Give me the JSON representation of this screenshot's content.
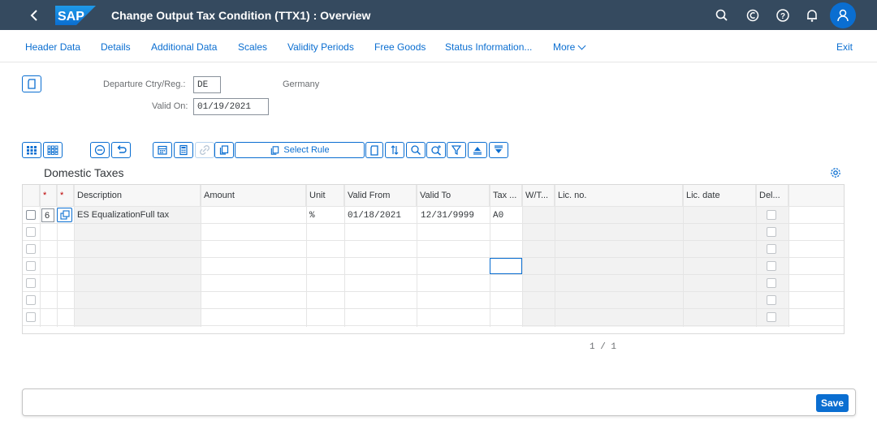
{
  "shell": {
    "title": "Change Output Tax Condition (TTX1) : Overview",
    "logo_text": "SAP"
  },
  "menu": {
    "items": [
      "Header Data",
      "Details",
      "Additional Data",
      "Scales",
      "Validity Periods",
      "Free Goods",
      "Status Information..."
    ],
    "more_label": "More",
    "exit_label": "Exit"
  },
  "form": {
    "country_label": "Departure Ctry/Reg.:",
    "country_value": "DE",
    "country_name": "Germany",
    "valid_on_label": "Valid On:",
    "valid_on_value": "01/19/2021"
  },
  "toolbar": {
    "select_rule_label": "Select Rule"
  },
  "section": {
    "title": "Domestic Taxes"
  },
  "table": {
    "required_marks": [
      "*",
      "*"
    ],
    "headers": {
      "description": "Description",
      "amount": "Amount",
      "unit": "Unit",
      "valid_from": "Valid From",
      "valid_to": "Valid To",
      "tax": "Tax ...",
      "wt": "W/T...",
      "lic_no": "Lic. no.",
      "lic_date": "Lic. date",
      "del": "Del..."
    },
    "rows": [
      {
        "col1": "6",
        "description": "ES EqualizationFull tax",
        "amount": "",
        "unit": "%",
        "valid_from": "01/18/2021",
        "valid_to": "12/31/9999",
        "tax": "A0",
        "wt": "",
        "lic_no": "",
        "lic_date": ""
      }
    ]
  },
  "pager": {
    "text": "1 /  1"
  },
  "footer": {
    "save_label": "Save"
  },
  "colors": {
    "shell_bg": "#354a5f",
    "accent": "#0a6ed1",
    "required": "#bb0000"
  }
}
